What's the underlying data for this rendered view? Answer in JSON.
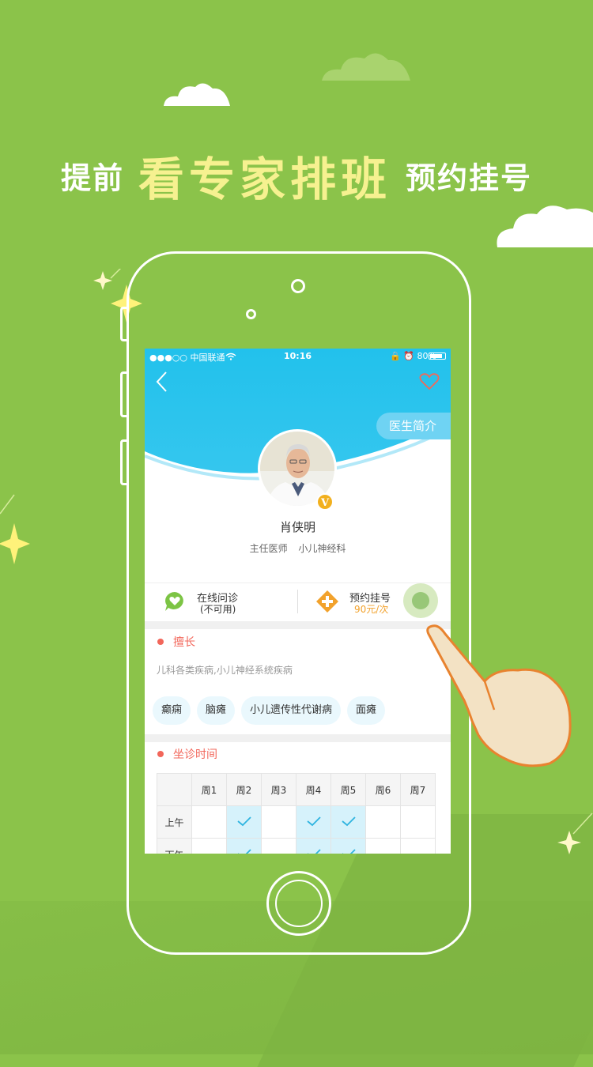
{
  "headline": {
    "prefix": "提前",
    "highlight": "看专家排班",
    "suffix": "预约挂号"
  },
  "status_bar": {
    "carrier": "●●●○○ 中国联通",
    "wifi_icon": "wifi-icon",
    "time": "10:16",
    "right": "🔒 ⏰ 80%"
  },
  "nav": {
    "back_icon": "chevron-left-icon",
    "favorite_icon": "heart-icon",
    "intro_label": "医生简介"
  },
  "doctor": {
    "name": "肖侠明",
    "title": "主任医师",
    "department": "小儿神经科",
    "badge": "V"
  },
  "services": [
    {
      "label": "在线问诊",
      "sub": "(不可用)",
      "icon": "chat-heart-icon"
    },
    {
      "label": "预约挂号",
      "sub": "90元/次",
      "icon": "plus-diamond-icon"
    }
  ],
  "specialty": {
    "title": "擅长",
    "text": "儿科各类疾病,小儿神经系统疾病",
    "tags": [
      "癫痫",
      "脑瘫",
      "小儿遗传性代谢病",
      "面瘫"
    ]
  },
  "schedule": {
    "title": "坐诊时间",
    "days": [
      "周1",
      "周2",
      "周3",
      "周4",
      "周5",
      "周6",
      "周7"
    ],
    "rows": [
      {
        "label": "上午",
        "on": [
          false,
          true,
          false,
          true,
          true,
          false,
          false
        ]
      },
      {
        "label": "下午",
        "on": [
          false,
          true,
          false,
          true,
          true,
          false,
          false
        ]
      }
    ],
    "check_icon": "check-icon"
  },
  "colors": {
    "background": "#8bc34a",
    "header": "#22c1ec",
    "accent_red": "#f2665a",
    "price": "#f2a22c"
  }
}
